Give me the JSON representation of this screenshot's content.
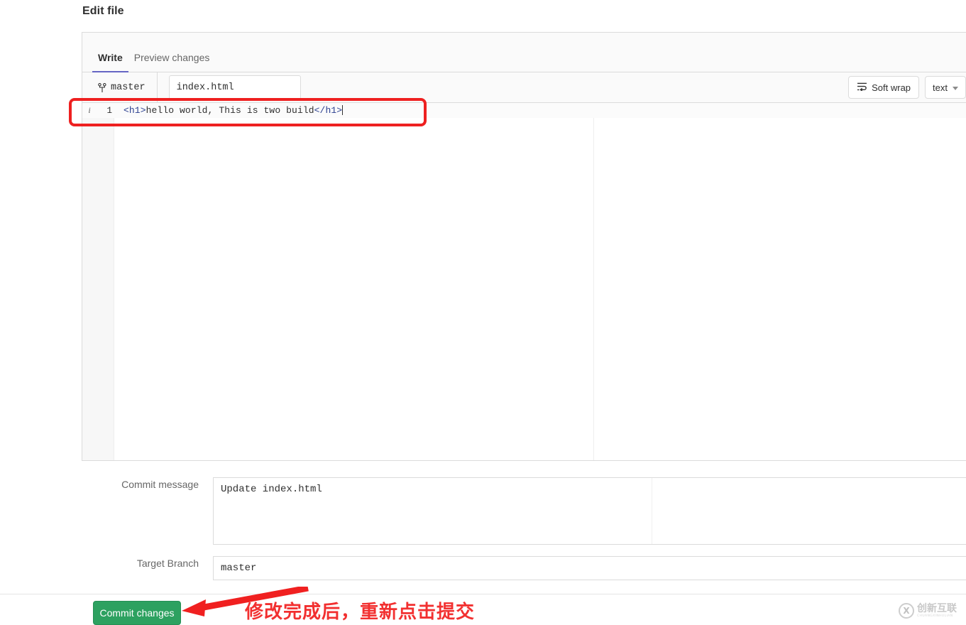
{
  "page": {
    "title": "Edit file"
  },
  "tabs": [
    {
      "label": "Write",
      "active": true
    },
    {
      "label": "Preview changes",
      "active": false
    }
  ],
  "toolbar": {
    "branch_icon": "git-branch-icon",
    "branch_name": "master",
    "file_name": "index.html",
    "soft_wrap_icon": "soft-wrap-icon",
    "soft_wrap_label": "Soft wrap",
    "mode_label": "text",
    "mode_caret_icon": "chevron-down-icon"
  },
  "editor": {
    "info_marker": "i",
    "line_number": "1",
    "code_open_tag": "<h1>",
    "code_body": "hello world, This is two build",
    "code_close_tag": "</h1>",
    "tag_color": "#2a3f8f"
  },
  "form": {
    "commit_message_label": "Commit message",
    "commit_message_value": "Update index.html",
    "target_branch_label": "Target Branch",
    "target_branch_value": "master"
  },
  "footer": {
    "commit_button_label": "Commit changes",
    "commit_button_color": "#2da160"
  },
  "annotation": {
    "text": "修改完成后，重新点击提交",
    "color": "#f23030",
    "arrow_icon": "left-arrow-icon",
    "highlight_box": "red-highlight-box"
  },
  "watermark": {
    "mark": "X",
    "cn_text": "创新互联",
    "en_text": "CHUANGXINHULIAN"
  }
}
